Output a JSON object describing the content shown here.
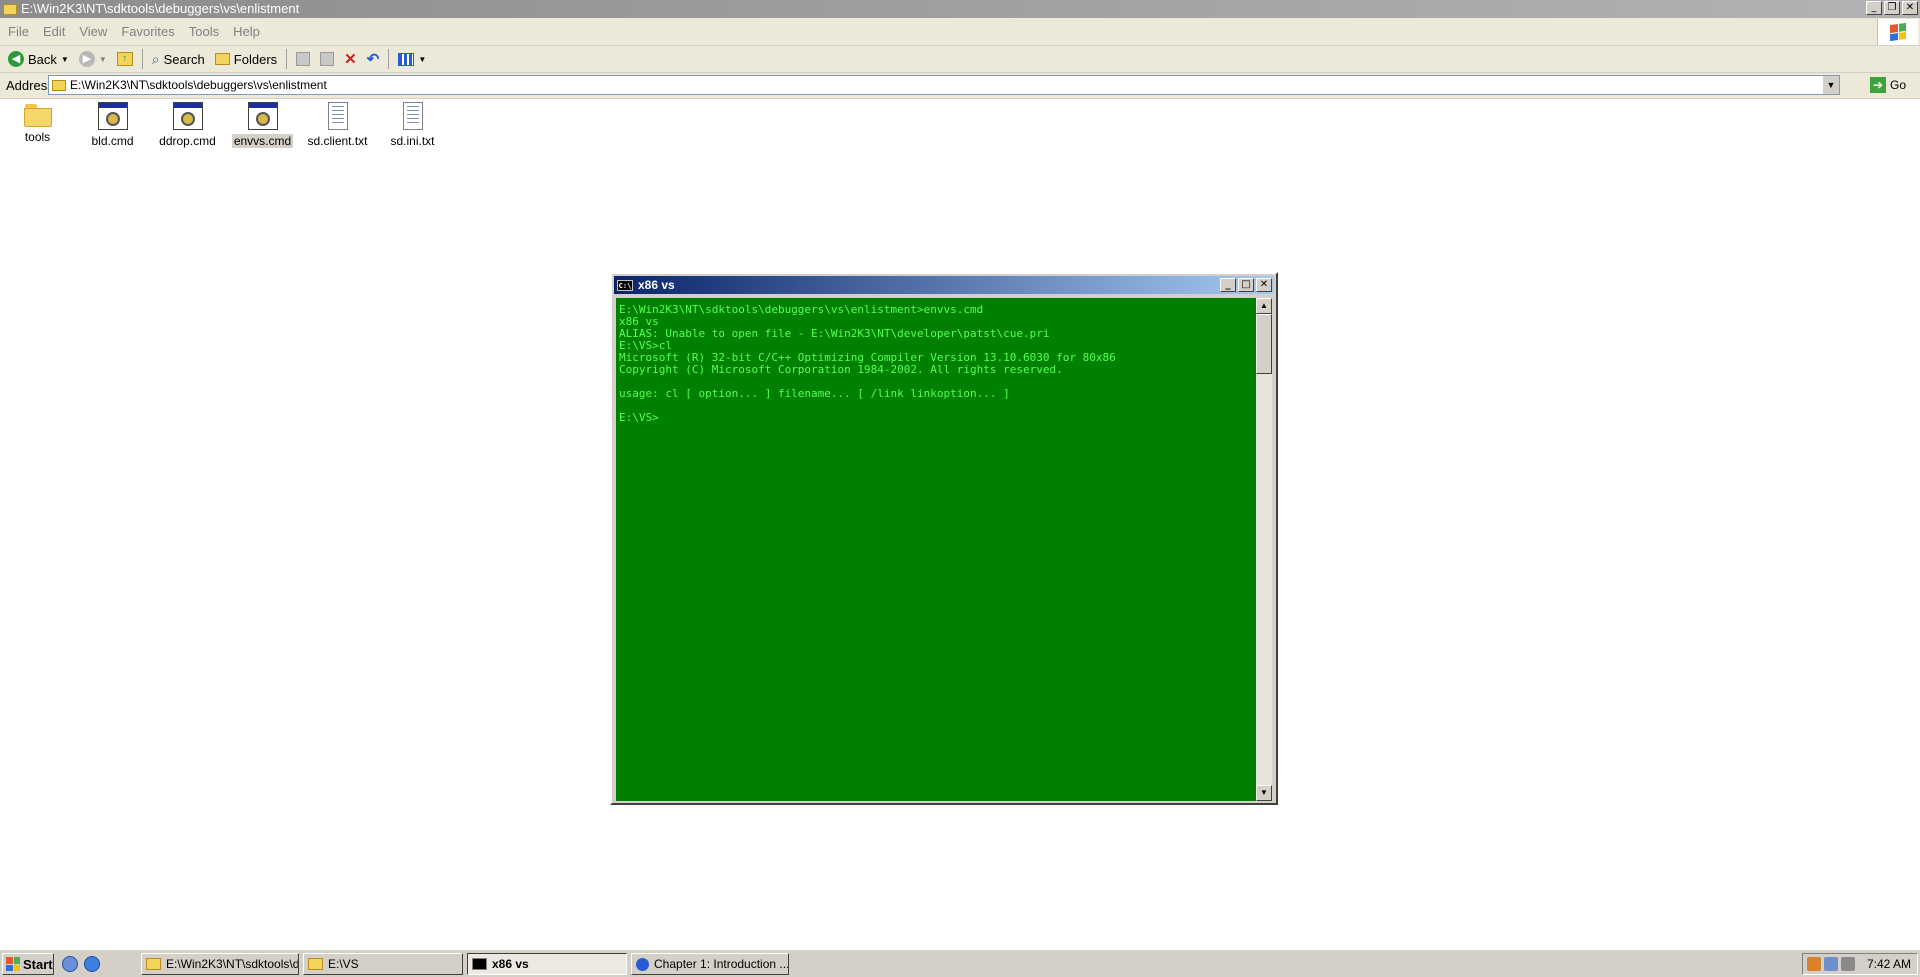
{
  "explorer": {
    "title": "E:\\Win2K3\\NT\\sdktools\\debuggers\\vs\\enlistment",
    "menu": [
      "File",
      "Edit",
      "View",
      "Favorites",
      "Tools",
      "Help"
    ],
    "toolbar": {
      "back": "Back",
      "search": "Search",
      "folders": "Folders"
    },
    "address_label": "Address",
    "address_value": "E:\\Win2K3\\NT\\sdktools\\debuggers\\vs\\enlistment",
    "go_label": "Go",
    "files": [
      {
        "name": "tools",
        "type": "folder"
      },
      {
        "name": "bld.cmd",
        "type": "cmd"
      },
      {
        "name": "ddrop.cmd",
        "type": "cmd"
      },
      {
        "name": "envvs.cmd",
        "type": "cmd",
        "selected": true
      },
      {
        "name": "sd.client.txt",
        "type": "txt"
      },
      {
        "name": "sd.ini.txt",
        "type": "txt"
      }
    ]
  },
  "console": {
    "title": "x86 vs",
    "icon_text": "C:\\",
    "background": "#008000",
    "text_color": "#55ff55",
    "lines": [
      "E:\\Win2K3\\NT\\sdktools\\debuggers\\vs\\enlistment>envvs.cmd",
      "x86 vs",
      "ALIAS: Unable to open file - E:\\Win2K3\\NT\\developer\\patst\\cue.pri",
      "E:\\VS>cl",
      "Microsoft (R) 32-bit C/C++ Optimizing Compiler Version 13.10.6030 for 80x86",
      "Copyright (C) Microsoft Corporation 1984-2002. All rights reserved.",
      "",
      "usage: cl [ option... ] filename... [ /link linkoption... ]",
      "",
      "E:\\VS>"
    ]
  },
  "taskbar": {
    "start_label": "Start",
    "tasks": [
      {
        "label": "E:\\Win2K3\\NT\\sdktools\\d...",
        "icon": "folder-icon",
        "active": false
      },
      {
        "label": "E:\\VS",
        "icon": "folder-icon",
        "active": false
      },
      {
        "label": "x86 vs",
        "icon": "console-icon",
        "active": true
      },
      {
        "label": "Chapter 1: Introduction ...",
        "icon": "help-icon",
        "active": false
      }
    ],
    "clock": "7:42 AM"
  }
}
